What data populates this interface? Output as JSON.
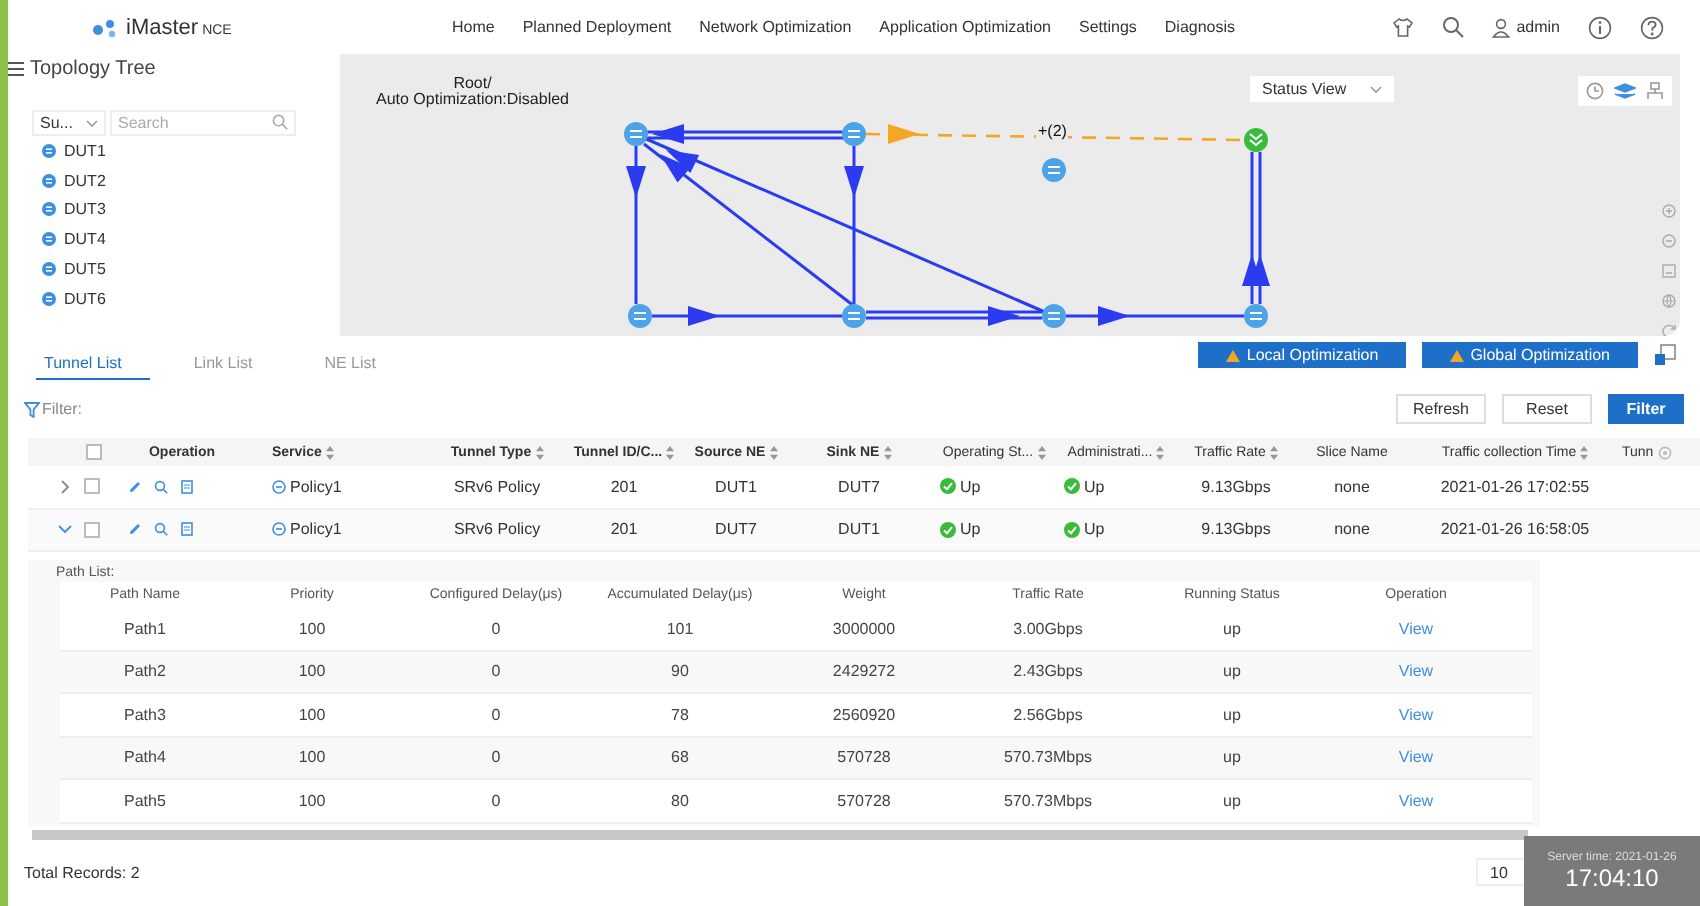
{
  "header": {
    "logo": "iMaster",
    "logo_suffix": "NCE",
    "nav": [
      {
        "label": "Home",
        "selected": false
      },
      {
        "label": "Planned Deployment",
        "selected": false
      },
      {
        "label": "Network Optimization",
        "selected": false
      },
      {
        "label": "Application Optimization",
        "selected": false
      },
      {
        "label": "Settings",
        "selected": false
      },
      {
        "label": "Diagnosis",
        "selected": false
      }
    ],
    "user": "admin"
  },
  "sidebar": {
    "title": "Topology Tree",
    "scope_select": "Su...",
    "search": {
      "placeholder": "Search"
    },
    "items": [
      {
        "label": "DUT1"
      },
      {
        "label": "DUT2"
      },
      {
        "label": "DUT3"
      },
      {
        "label": "DUT4"
      },
      {
        "label": "DUT5"
      },
      {
        "label": "DUT6"
      }
    ]
  },
  "topology": {
    "caption": [
      "Root/",
      "Auto Optimization:Disabled"
    ],
    "view_select": "Status View",
    "link_label": "+(2)"
  },
  "actions": [
    "Local Optimization",
    "Global Optimization"
  ],
  "tabs": [
    {
      "label": "Tunnel List",
      "selected": true
    },
    {
      "label": "Link List",
      "selected": false
    },
    {
      "label": "NE List",
      "selected": false
    }
  ],
  "filter_label": "Filter:",
  "buttons": [
    {
      "label": "Refresh",
      "kind": "plain"
    },
    {
      "label": "Reset",
      "kind": "plain"
    },
    {
      "label": "Filter",
      "kind": "primary"
    }
  ],
  "table": {
    "select_all_checked": false,
    "columns": [
      {
        "sortable": false
      },
      {
        "label": "Operation",
        "sortable": false
      },
      {
        "label": "Service",
        "sortable": true
      },
      {
        "label": "Tunnel Type",
        "sortable": true
      },
      {
        "label": "Tunnel ID/C...",
        "sortable": true
      },
      {
        "label": "Source NE",
        "sortable": true
      },
      {
        "label": "Sink NE",
        "sortable": true
      },
      {
        "label": "Operating St...",
        "sortable": true
      },
      {
        "label": "Administrati...",
        "sortable": true
      },
      {
        "label": "Traffic Rate",
        "sortable": true
      },
      {
        "label": "Slice Name",
        "sortable": false
      },
      {
        "label": "Traffic collection Time",
        "sortable": true
      },
      {
        "label": "Tunn",
        "sortable": false
      }
    ],
    "rows": [
      {
        "expanded": false,
        "checked": false,
        "service": "Policy1",
        "tunnel_type": "SRv6 Policy",
        "tunnel_id": "201",
        "source_ne": "DUT1",
        "sink_ne": "DUT7",
        "operating_status": "Up",
        "admin_status": "Up",
        "traffic_rate": "9.13Gbps",
        "slice_name": "none",
        "collection_time": "2021-01-26 17:02:55"
      },
      {
        "expanded": true,
        "checked": false,
        "service": "Policy1",
        "tunnel_type": "SRv6 Policy",
        "tunnel_id": "201",
        "source_ne": "DUT7",
        "sink_ne": "DUT1",
        "operating_status": "Up",
        "admin_status": "Up",
        "traffic_rate": "9.13Gbps",
        "slice_name": "none",
        "collection_time": "2021-01-26 16:58:05"
      }
    ]
  },
  "path_list": {
    "title": "Path List:",
    "columns": [
      "Path Name",
      "Priority",
      "Configured Delay(μs)",
      "Accumulated Delay(μs)",
      "Weight",
      "Traffic Rate",
      "Running Status",
      "Operation"
    ],
    "rows": [
      [
        "Path1",
        "100",
        "0",
        "101",
        "3000000",
        "3.00Gbps",
        "up",
        "View"
      ],
      [
        "Path2",
        "100",
        "0",
        "90",
        "2429272",
        "2.43Gbps",
        "up",
        "View"
      ],
      [
        "Path3",
        "100",
        "0",
        "78",
        "2560920",
        "2.56Gbps",
        "up",
        "View"
      ],
      [
        "Path4",
        "100",
        "0",
        "68",
        "570728",
        "570.73Mbps",
        "up",
        "View"
      ],
      [
        "Path5",
        "100",
        "0",
        "80",
        "570728",
        "570.73Mbps",
        "up",
        "View"
      ]
    ]
  },
  "footer": {
    "total": "Total Records: 2",
    "page_size": "10",
    "server_time_label": "Server time: 2021-01-26",
    "server_time": "17:04:10"
  }
}
